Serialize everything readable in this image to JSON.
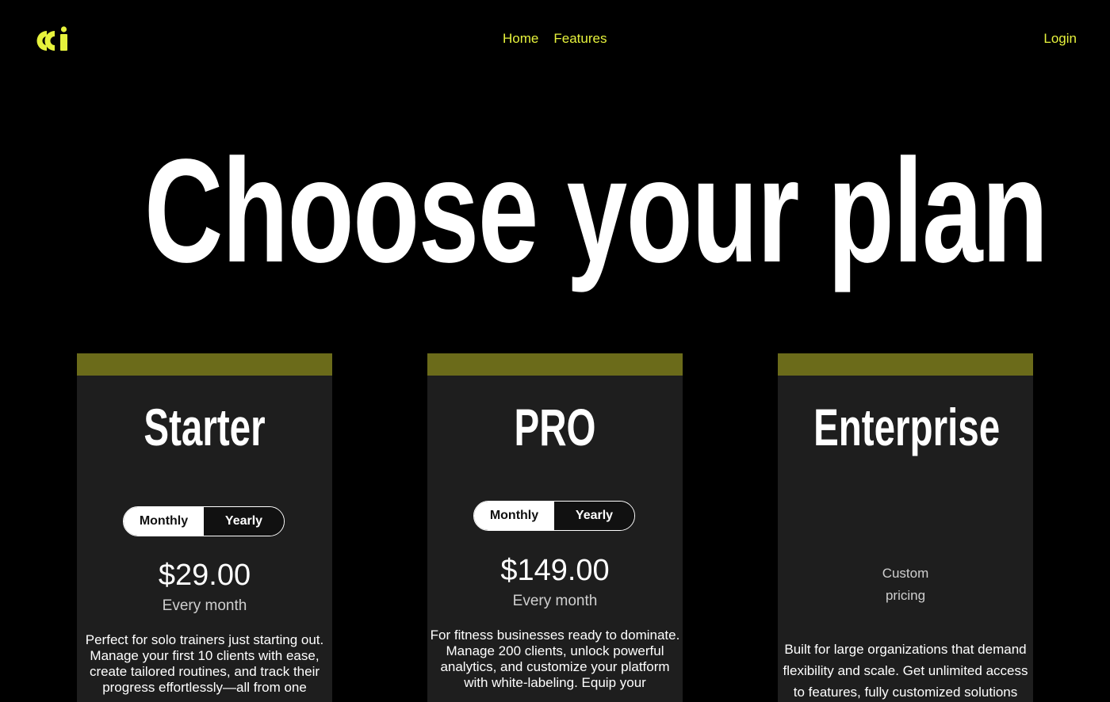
{
  "nav": {
    "logo_name": "brand-logo",
    "links": [
      {
        "label": "Home"
      },
      {
        "label": "Features"
      }
    ],
    "login_label": "Login"
  },
  "hero": {
    "title": "Choose your plan"
  },
  "plans": [
    {
      "name": "Starter",
      "toggle": {
        "monthly": "Monthly",
        "yearly": "Yearly",
        "selected": "Monthly"
      },
      "price": "$29.00",
      "period": "Every month",
      "description": "Perfect for solo trainers just starting out. Manage your first 10 clients with ease, create tailored routines, and track their progress effortlessly—all from one"
    },
    {
      "name": "PRO",
      "toggle": {
        "monthly": "Monthly",
        "yearly": "Yearly",
        "selected": "Monthly"
      },
      "price": "$149.00",
      "period": "Every month",
      "description": "For fitness businesses ready to dominate. Manage 200 clients, unlock powerful analytics, and customize your platform with white-labeling. Equip your"
    },
    {
      "name": "Enterprise",
      "custom_pricing_line1": "Custom",
      "custom_pricing_line2": "pricing",
      "description": "Built for large organizations that demand flexibility and scale. Get unlimited access to features, fully customized solutions"
    }
  ],
  "colors": {
    "accent": "#e6f23c",
    "card_band": "#6b6b1a",
    "card_bg": "#1e1e1e",
    "background": "#000000"
  }
}
